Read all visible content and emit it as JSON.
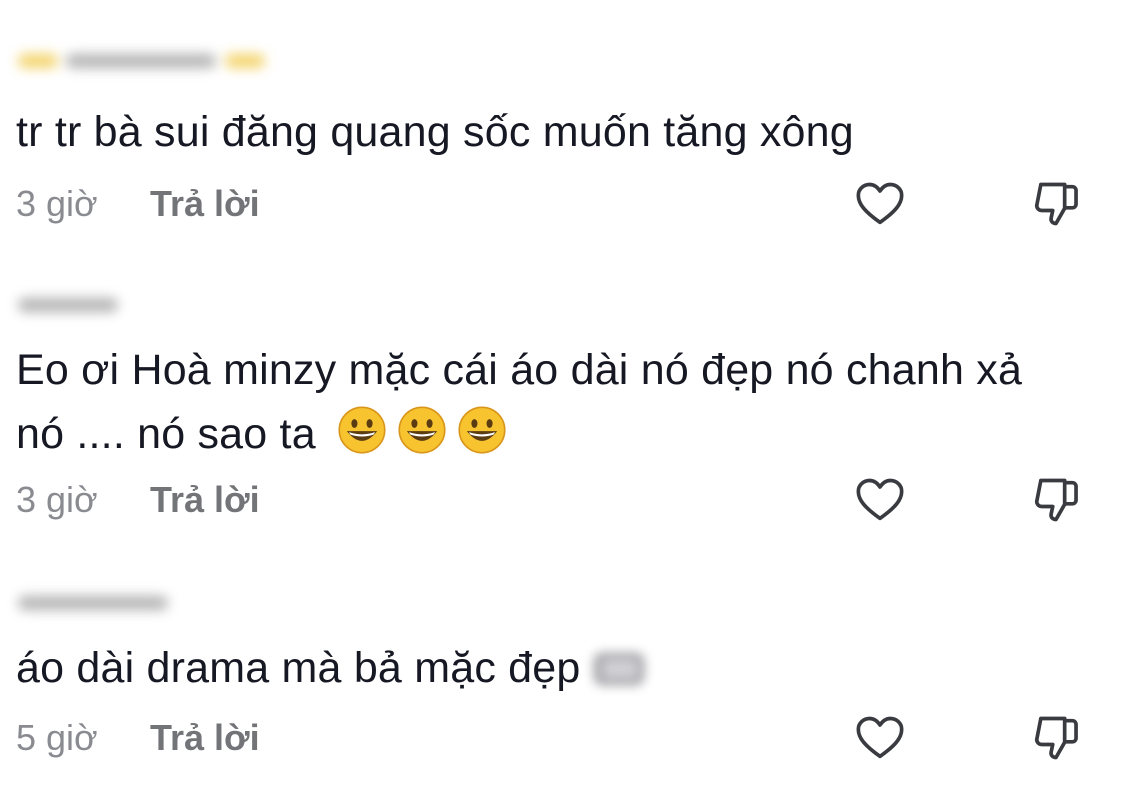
{
  "comments": [
    {
      "text": "tr tr bà sui đăng quang sốc muốn tăng xông",
      "time": "3 giờ",
      "reply_label": "Trả lời"
    },
    {
      "text_line1": "Eo ơi Hoà minzy mặc cái áo dài nó đẹp nó chanh xả",
      "text_line2": "nó .... nó sao ta",
      "emojis": [
        "😀",
        "😀",
        "😀"
      ],
      "time": "3 giờ",
      "reply_label": "Trả lời"
    },
    {
      "text": "áo dài drama mà bả mặc đẹp",
      "time": "5 giờ",
      "reply_label": "Trả lời"
    }
  ],
  "icons": {
    "like": "heart-outline-icon",
    "dislike": "thumbs-down-outline-icon",
    "emoji": "grinning-face-emoji"
  },
  "colors": {
    "text": "#161823",
    "meta": "#8a8b91",
    "reply": "#737478",
    "icon": "#3a3b40"
  }
}
